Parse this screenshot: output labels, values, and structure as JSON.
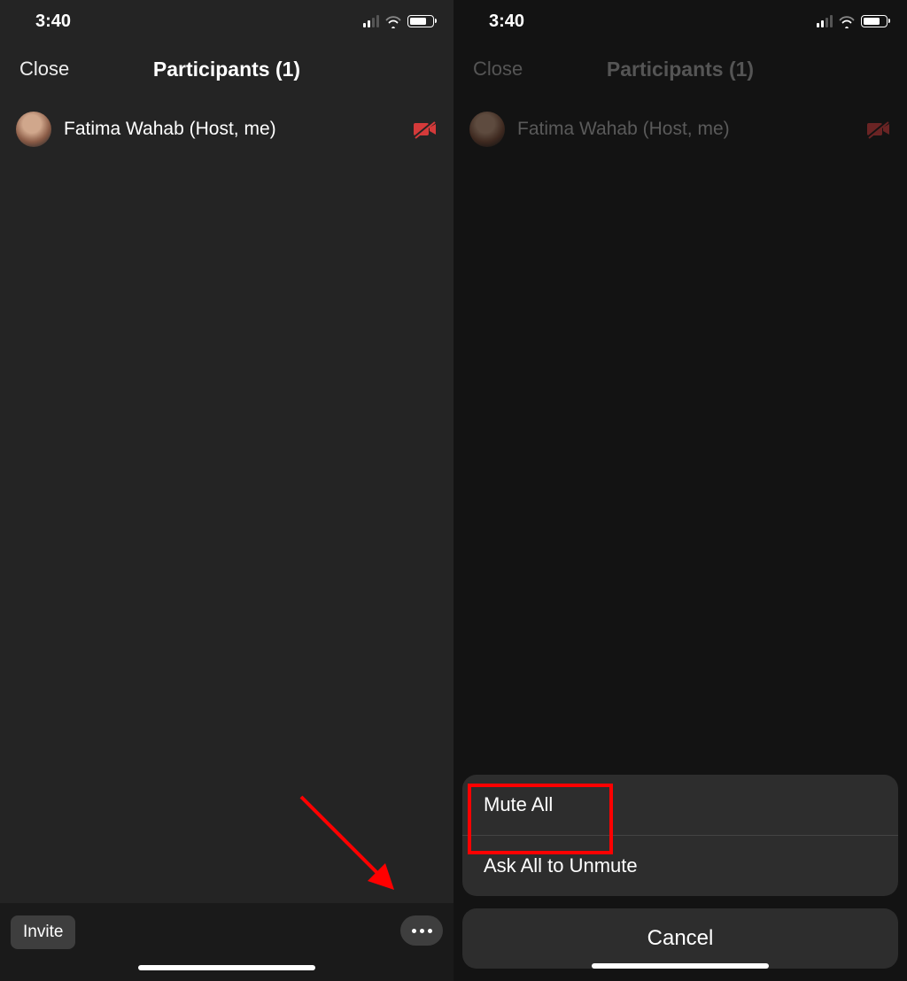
{
  "status": {
    "time": "3:40"
  },
  "nav": {
    "close_label": "Close",
    "title": "Participants (1)"
  },
  "participants": [
    {
      "name": "Fatima Wahab (Host, me)"
    }
  ],
  "bottom": {
    "invite_label": "Invite"
  },
  "sheet": {
    "mute_all_label": "Mute All",
    "ask_unmute_label": "Ask All to Unmute",
    "cancel_label": "Cancel"
  },
  "colors": {
    "video_off_icon": "#d43a3a",
    "highlight": "#ff0000"
  }
}
